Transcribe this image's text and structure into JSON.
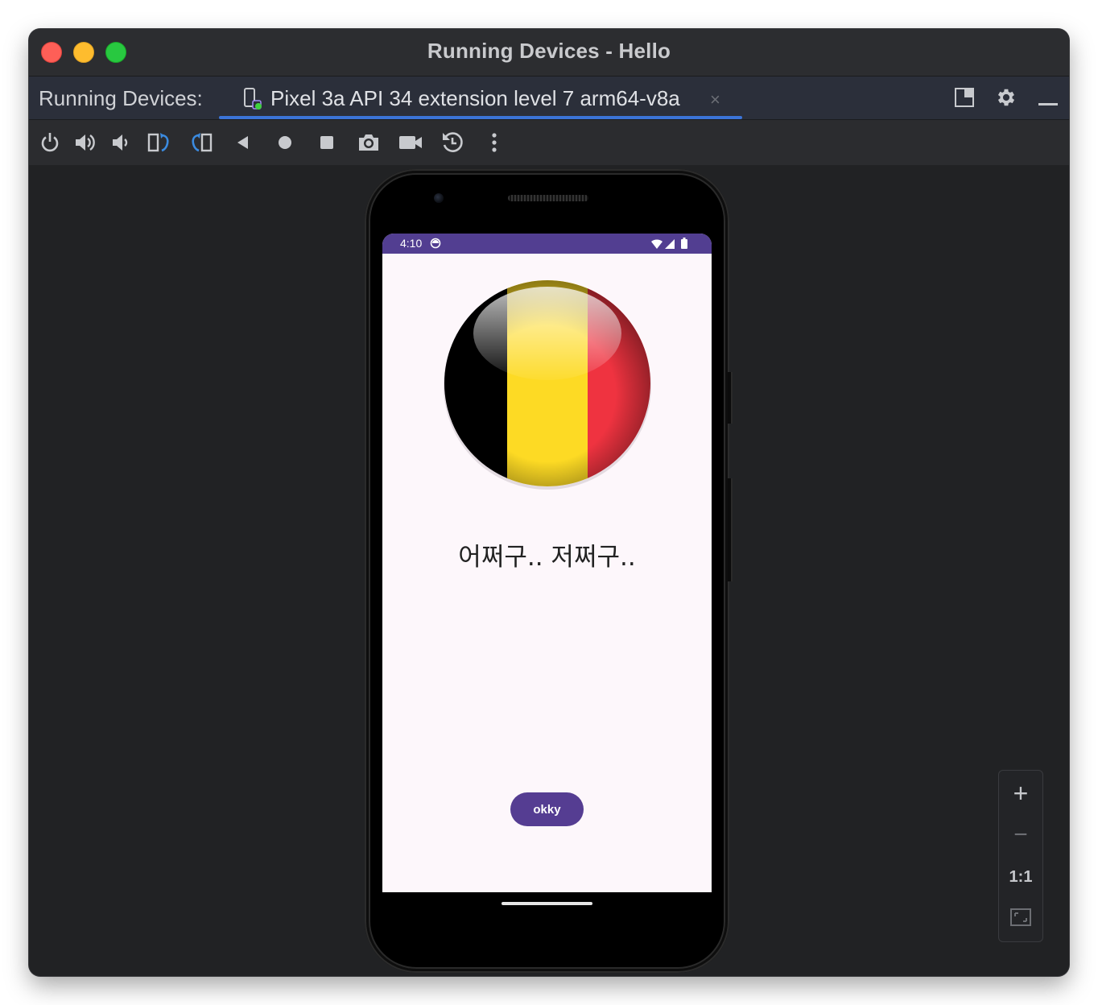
{
  "window": {
    "title": "Running Devices - Hello"
  },
  "tabbar": {
    "label": "Running Devices:",
    "active_tab": "Pixel 3a API 34 extension level 7 arm64-v8a",
    "close_glyph": "×"
  },
  "toolbar": {
    "icons": [
      "power-icon",
      "volume-up-icon",
      "volume-down-icon",
      "rotate-left-icon",
      "rotate-right-icon",
      "back-icon",
      "home-icon",
      "overview-icon",
      "screenshot-icon",
      "screen-record-icon",
      "reset-icon",
      "more-icon"
    ]
  },
  "phone": {
    "status_time": "4:10",
    "app_text": "어쩌구.. 저쩌구..",
    "button_label": "okky",
    "flag_colors": [
      "#000000",
      "#FDDA24",
      "#EF3340"
    ]
  },
  "zoom": {
    "zoom_in": "+",
    "zoom_out": "−",
    "actual_size": "1:1"
  },
  "colors": {
    "accent": "#3b74d8",
    "statusbar": "#523e91",
    "button": "#553d92"
  }
}
